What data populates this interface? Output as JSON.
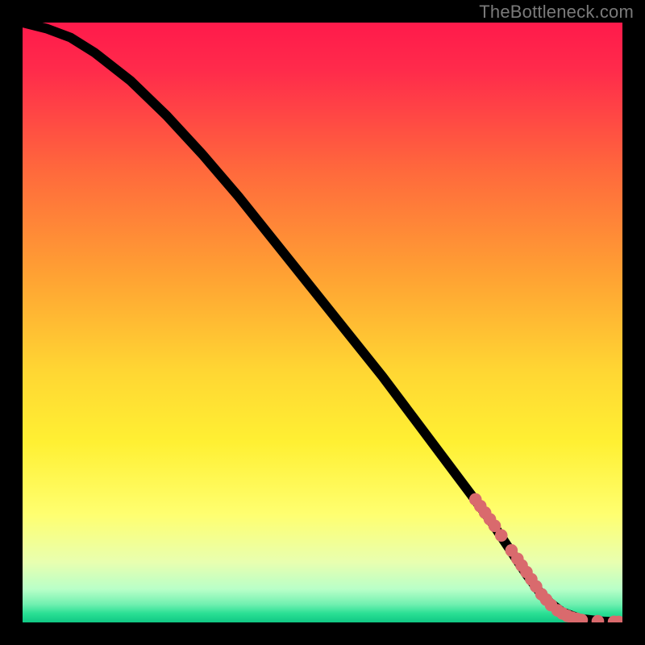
{
  "attribution": "TheBottleneck.com",
  "chart_data": {
    "type": "line",
    "title": "",
    "xlabel": "",
    "ylabel": "",
    "xlim": [
      0,
      100
    ],
    "ylim": [
      0,
      100
    ],
    "grid": false,
    "background": "rainbow-gradient-red-yellow-green",
    "series": [
      {
        "name": "curve",
        "x": [
          0,
          4,
          8,
          12,
          18,
          24,
          30,
          36,
          42,
          48,
          54,
          60,
          66,
          72,
          78,
          81,
          84,
          87,
          90,
          93,
          97,
          100
        ],
        "y": [
          100,
          99,
          97.5,
          95,
          90.3,
          84.5,
          78,
          71,
          63.5,
          56,
          48.5,
          41,
          33,
          25,
          17,
          12.5,
          8,
          4,
          1.7,
          0.6,
          0.15,
          0.05
        ]
      }
    ],
    "markers": [
      {
        "x": 75.5,
        "y": 20.5
      },
      {
        "x": 76.3,
        "y": 19.4
      },
      {
        "x": 77.1,
        "y": 18.3
      },
      {
        "x": 77.9,
        "y": 17.2
      },
      {
        "x": 78.7,
        "y": 16.1
      },
      {
        "x": 79.8,
        "y": 14.5
      },
      {
        "x": 81.5,
        "y": 12.0
      },
      {
        "x": 82.5,
        "y": 10.6
      },
      {
        "x": 83.2,
        "y": 9.5
      },
      {
        "x": 84.0,
        "y": 8.4
      },
      {
        "x": 84.8,
        "y": 7.2
      },
      {
        "x": 85.6,
        "y": 6.0
      },
      {
        "x": 86.5,
        "y": 4.7
      },
      {
        "x": 87.3,
        "y": 3.8
      },
      {
        "x": 88.1,
        "y": 2.9
      },
      {
        "x": 89.2,
        "y": 2.0
      },
      {
        "x": 90.0,
        "y": 1.5
      },
      {
        "x": 90.8,
        "y": 1.1
      },
      {
        "x": 91.6,
        "y": 0.8
      },
      {
        "x": 92.4,
        "y": 0.6
      },
      {
        "x": 93.2,
        "y": 0.4
      },
      {
        "x": 95.9,
        "y": 0.2
      },
      {
        "x": 98.6,
        "y": 0.1
      },
      {
        "x": 99.4,
        "y": 0.07
      }
    ],
    "marker_radius": 1.05,
    "gradient_stops": [
      {
        "offset": 0.0,
        "color": "#ff1a4b"
      },
      {
        "offset": 0.08,
        "color": "#ff2b4b"
      },
      {
        "offset": 0.25,
        "color": "#ff6a3c"
      },
      {
        "offset": 0.42,
        "color": "#ffa133"
      },
      {
        "offset": 0.58,
        "color": "#ffd633"
      },
      {
        "offset": 0.7,
        "color": "#fff033"
      },
      {
        "offset": 0.82,
        "color": "#ffff70"
      },
      {
        "offset": 0.9,
        "color": "#e8ffb0"
      },
      {
        "offset": 0.945,
        "color": "#b8ffc8"
      },
      {
        "offset": 0.97,
        "color": "#70f0b0"
      },
      {
        "offset": 0.985,
        "color": "#2adf94"
      },
      {
        "offset": 1.0,
        "color": "#10c884"
      }
    ]
  }
}
